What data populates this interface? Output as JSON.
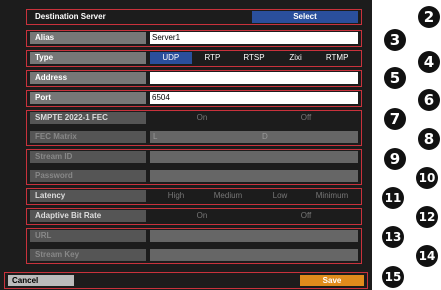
{
  "destination": {
    "label": "Destination Server",
    "button": "Select"
  },
  "alias": {
    "label": "Alias",
    "value": "Server1"
  },
  "type": {
    "label": "Type",
    "options": [
      "UDP",
      "RTP",
      "RTSP",
      "Zixi",
      "RTMP"
    ],
    "selected": "UDP"
  },
  "address": {
    "label": "Address",
    "value": ""
  },
  "port": {
    "label": "Port",
    "value": "6504"
  },
  "smpte": {
    "label": "SMPTE 2022-1 FEC",
    "options": [
      "On",
      "Off"
    ]
  },
  "fec_matrix": {
    "label": "FEC Matrix",
    "l": "L",
    "d": "D"
  },
  "stream_id": {
    "label": "Stream ID"
  },
  "password": {
    "label": "Password"
  },
  "latency": {
    "label": "Latency",
    "options": [
      "High",
      "Medium",
      "Low",
      "Minimum"
    ]
  },
  "adaptive_bit_rate": {
    "label": "Adaptive Bit Rate",
    "options": [
      "On",
      "Off"
    ]
  },
  "url": {
    "label": "URL"
  },
  "stream_key": {
    "label": "Stream Key"
  },
  "footer": {
    "cancel": "Cancel",
    "save": "Save"
  },
  "callouts": [
    "2",
    "3",
    "4",
    "5",
    "6",
    "7",
    "8",
    "9",
    "10",
    "11",
    "12",
    "13",
    "14",
    "15"
  ],
  "colors": {
    "accent": "#c8323c",
    "selected": "#2a4f9c",
    "save": "#e08c1c",
    "panel": "#1c1c1c"
  }
}
